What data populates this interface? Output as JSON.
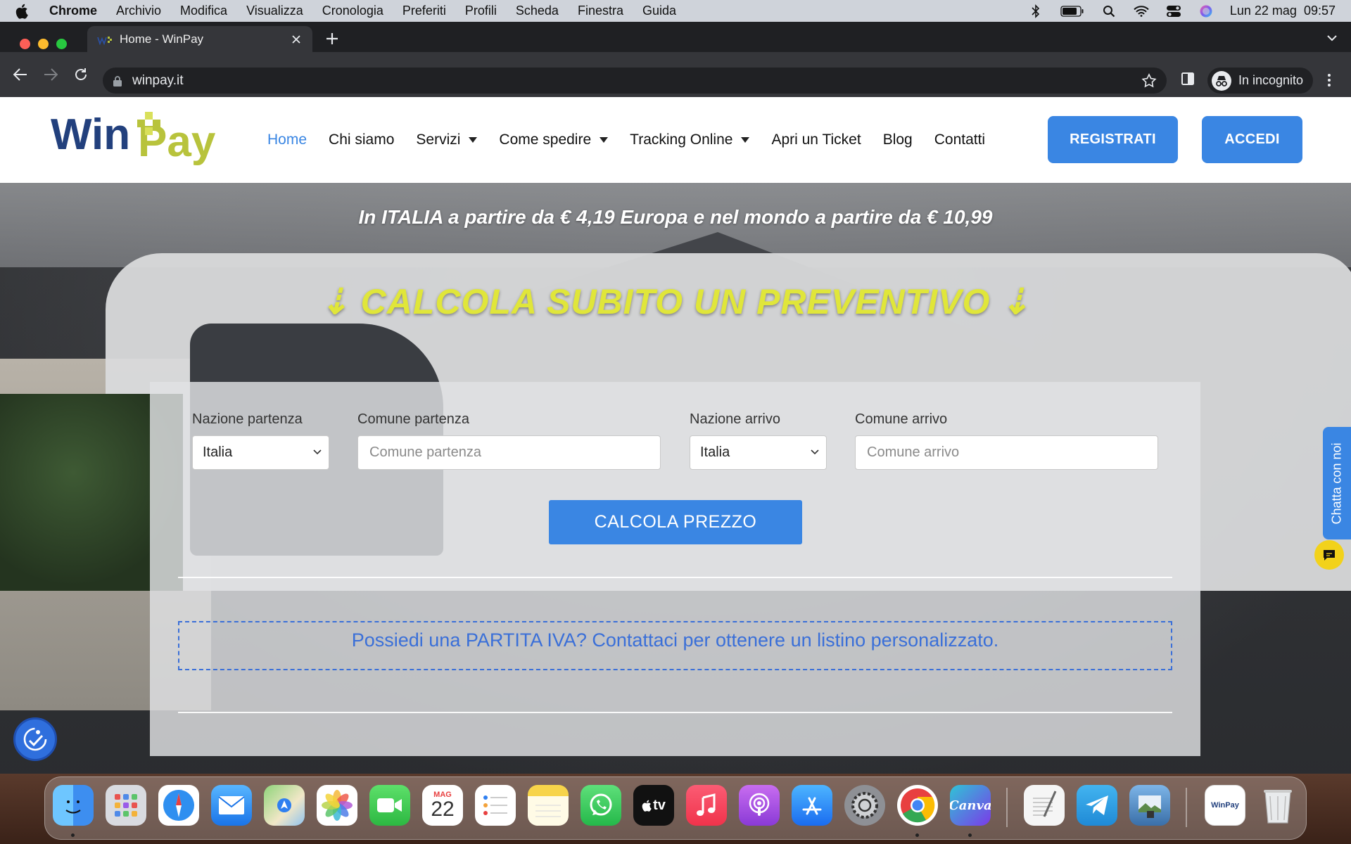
{
  "menubar": {
    "items": [
      "Chrome",
      "Archivio",
      "Modifica",
      "Visualizza",
      "Cronologia",
      "Preferiti",
      "Profili",
      "Scheda",
      "Finestra",
      "Guida"
    ],
    "datetime": "Lun 22 mag  09:57",
    "status_icons": [
      "bluetooth-icon",
      "battery-icon",
      "spotlight-search-icon",
      "wifi-icon",
      "control-center-icon",
      "siri-icon"
    ]
  },
  "browser": {
    "tab_title": "Home - WinPay",
    "url": "winpay.it",
    "profile_label": "In incognito"
  },
  "site": {
    "logo_text_win": "Win",
    "logo_text_pay": "Pay",
    "nav": [
      {
        "label": "Home",
        "active": true,
        "dropdown": false
      },
      {
        "label": "Chi siamo",
        "active": false,
        "dropdown": false
      },
      {
        "label": "Servizi",
        "active": false,
        "dropdown": true
      },
      {
        "label": "Come spedire",
        "active": false,
        "dropdown": true
      },
      {
        "label": "Tracking Online",
        "active": false,
        "dropdown": true
      },
      {
        "label": "Apri un Ticket",
        "active": false,
        "dropdown": false
      },
      {
        "label": "Blog",
        "active": false,
        "dropdown": false
      },
      {
        "label": "Contatti",
        "active": false,
        "dropdown": false
      }
    ],
    "register_label": "REGISTRATI",
    "login_label": "ACCEDI"
  },
  "hero": {
    "promo": "In ITALIA a partire da € 4,19 Europa e nel mondo a partire da € 10,99",
    "heading": "⇣ CALCOLA SUBITO UN PREVENTIVO ⇣"
  },
  "form": {
    "origin_country_label": "Nazione partenza",
    "origin_country_value": "Italia",
    "origin_city_label": "Comune partenza",
    "origin_city_placeholder": "Comune partenza",
    "dest_country_label": "Nazione arrivo",
    "dest_country_value": "Italia",
    "dest_city_label": "Comune arrivo",
    "dest_city_placeholder": "Comune arrivo",
    "submit_label": "CALCOLA PREZZO",
    "vat_notice": "Possiedi una PARTITA IVA? Contattaci per ottenere un listino personalizzato."
  },
  "chat": {
    "label": "Chatta con noi"
  },
  "dock": {
    "calendar_month": "MAG",
    "calendar_day": "22",
    "apps": [
      "finder-icon",
      "launchpad-icon",
      "safari-icon",
      "mail-icon",
      "maps-icon",
      "photos-icon",
      "facetime-icon",
      "calendar-icon",
      "reminders-icon",
      "notes-icon",
      "whatsapp-icon",
      "apple-tv-icon",
      "music-icon",
      "podcasts-icon",
      "app-store-icon",
      "system-settings-icon",
      "chrome-icon",
      "canva-icon",
      "textedit-icon",
      "telegram-icon",
      "preview-icon",
      "winpay-document-icon",
      "trash-icon"
    ],
    "canva_label": "Canva",
    "tv_label": "tv",
    "winpay_label": "WinPay"
  },
  "colors": {
    "accent": "#3a86e3",
    "heading_yellow": "#e0e63a",
    "vat_blue": "#3a6fd8"
  }
}
